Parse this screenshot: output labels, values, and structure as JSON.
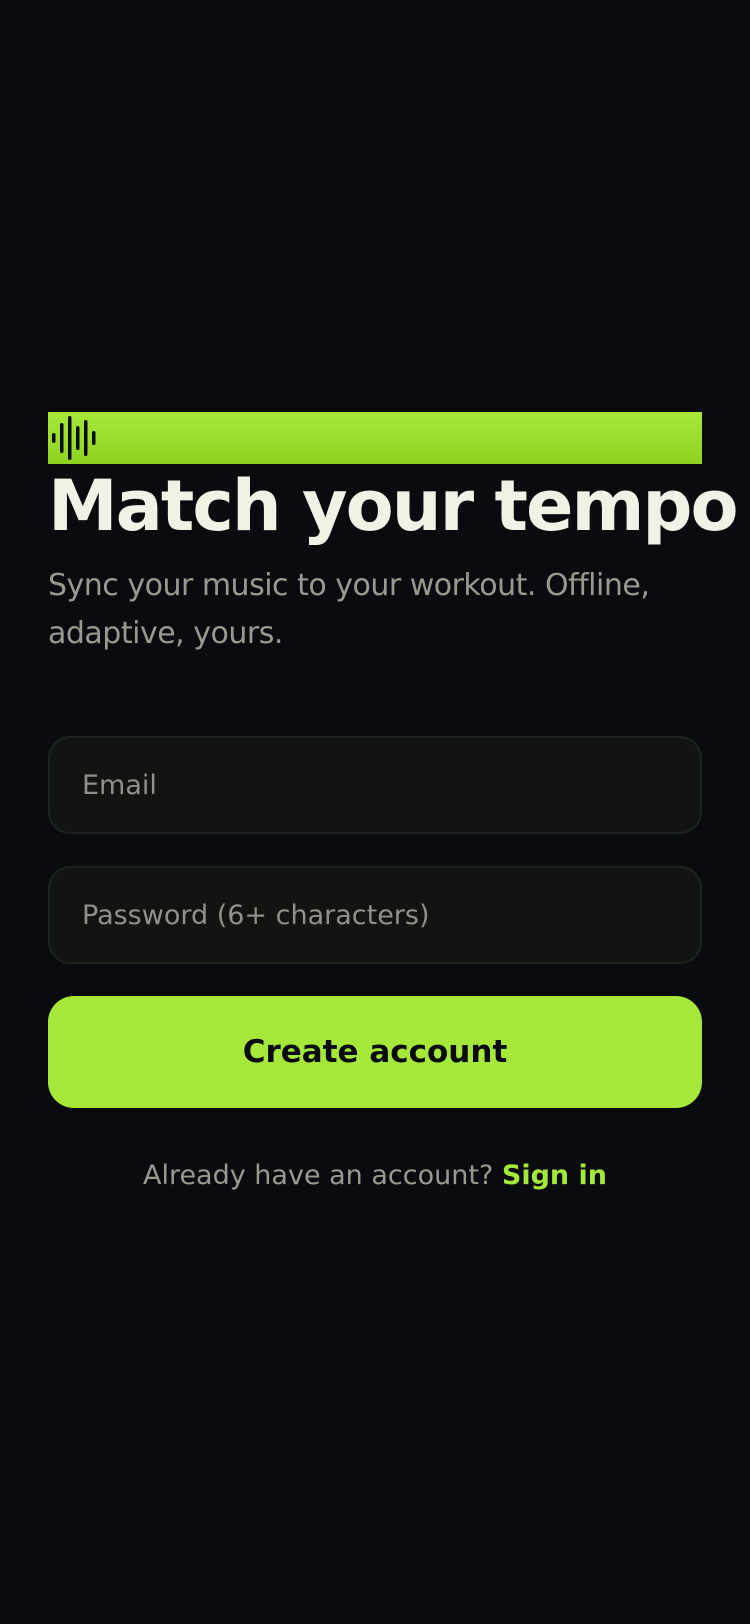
{
  "brand": {
    "logo_icon": "waveform-icon",
    "accent_color": "#a6e83a",
    "background_color": "#0a0b0f"
  },
  "hero": {
    "title": "Match your tempo",
    "subtitle": "Sync your music to your workout. Offline, adaptive, yours."
  },
  "form": {
    "email": {
      "value": "",
      "placeholder": "Email"
    },
    "password": {
      "value": "",
      "placeholder": "Password (6+ characters)"
    },
    "submit_label": "Create account"
  },
  "footer": {
    "prompt": "Already have an account?",
    "link_label": "Sign in"
  }
}
